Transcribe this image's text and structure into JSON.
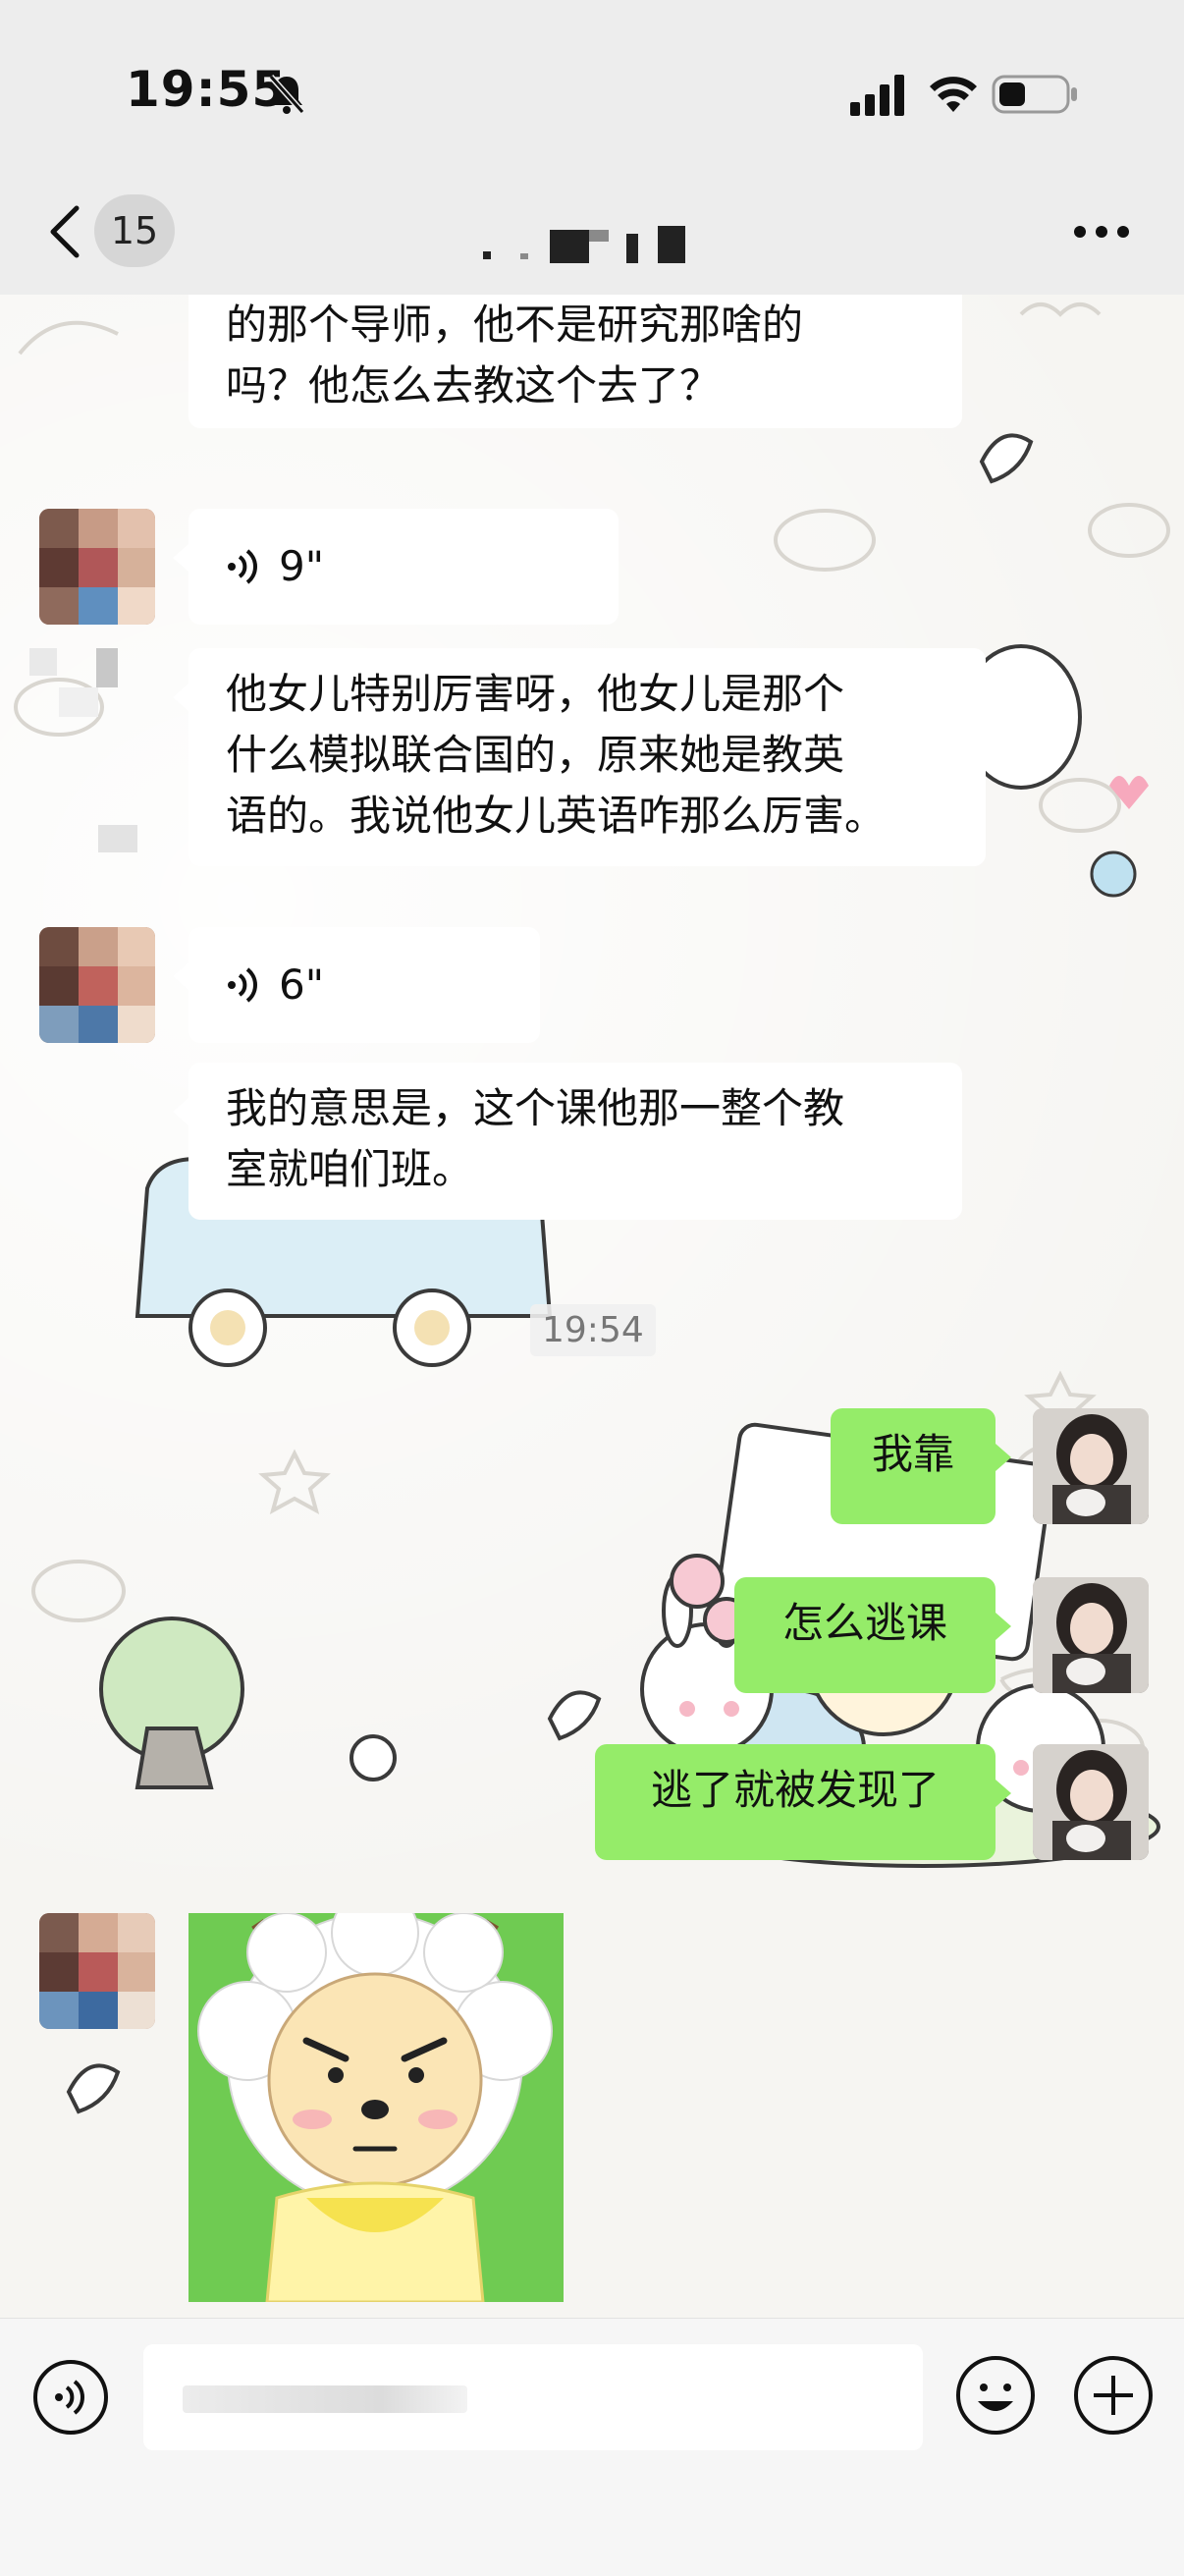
{
  "status_bar": {
    "time": "19:55",
    "icons": [
      "bell-off-icon",
      "signal-icon",
      "wifi-icon",
      "battery-icon"
    ]
  },
  "nav": {
    "unread_count": "15",
    "back_icon": "chevron-left-icon",
    "more_icon": "ellipsis-icon"
  },
  "messages": [
    {
      "side": "left",
      "kind": "text",
      "text_lines": [
        "的那个导师，他不是研究那啥的",
        "吗？他怎么去教这个去了？"
      ]
    },
    {
      "side": "left",
      "kind": "voice",
      "duration": "9\""
    },
    {
      "side": "left",
      "kind": "text",
      "text_lines": [
        "他女儿特别厉害呀，他女儿是那个",
        "什么模拟联合国的，原来她是教英",
        "语的。我说他女儿英语咋那么厉害。"
      ]
    },
    {
      "side": "left",
      "kind": "voice",
      "duration": "6\""
    },
    {
      "side": "left",
      "kind": "text",
      "text_lines": [
        "我的意思是，这个课他那一整个教",
        "室就咱们班。"
      ]
    },
    {
      "side": "right",
      "kind": "text",
      "text_lines": [
        "我靠"
      ]
    },
    {
      "side": "right",
      "kind": "text",
      "text_lines": [
        "怎么逃课"
      ]
    },
    {
      "side": "right",
      "kind": "text",
      "text_lines": [
        "逃了就被发现了"
      ]
    },
    {
      "side": "left",
      "kind": "sticker",
      "sticker": "angry-sheep-sticker"
    }
  ],
  "time_divider": "19:54",
  "colors": {
    "self_bubble": "#95ec69",
    "other_bubble": "#ffffff",
    "nav_bg": "#ededed"
  },
  "input_bar": {
    "left_icon": "voice-mode-icon",
    "right_icons": [
      "emoji-icon",
      "plus-icon"
    ]
  }
}
